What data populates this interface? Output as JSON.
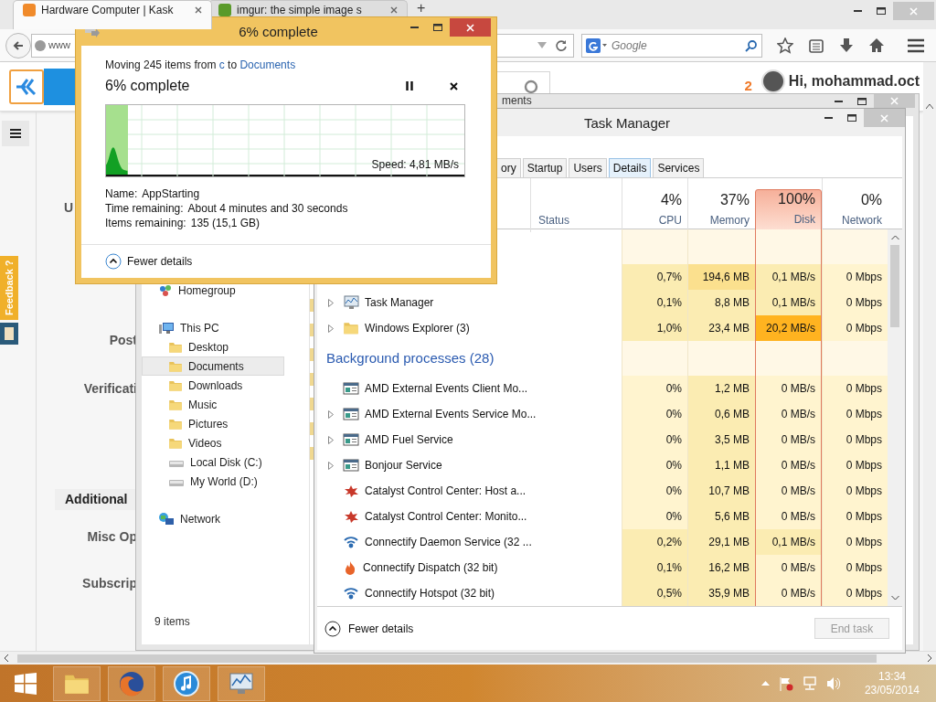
{
  "browser": {
    "tabs": [
      {
        "title": "Hardware Computer | Kask",
        "selected": true
      },
      {
        "title": "imgur: the simple image s",
        "selected": false
      }
    ],
    "new_tab": "+",
    "address": "www",
    "search_placeholder": "Google",
    "page": {
      "notification_count": "2",
      "greeting": "Hi, mohammad.oct",
      "feedback": "Feedback ?",
      "labels": [
        {
          "kind": "field",
          "text": "U"
        },
        {
          "kind": "field",
          "text": "Post"
        },
        {
          "kind": "field",
          "text": "Verificati"
        },
        {
          "kind": "section",
          "text": "Additional"
        },
        {
          "kind": "field",
          "text": "Misc Op"
        },
        {
          "kind": "field",
          "text": "Subscrip"
        }
      ]
    }
  },
  "explorer": {
    "title": "ments",
    "nav": [
      {
        "label": "Homegroup",
        "kind": "homegroup",
        "selected": false
      },
      {
        "label": "This PC",
        "kind": "pc",
        "selected": false,
        "children": [
          {
            "label": "Desktop",
            "kind": "folder",
            "selected": false
          },
          {
            "label": "Documents",
            "kind": "folder",
            "selected": true
          },
          {
            "label": "Downloads",
            "kind": "folder",
            "selected": false
          },
          {
            "label": "Music",
            "kind": "folder",
            "selected": false
          },
          {
            "label": "Pictures",
            "kind": "folder",
            "selected": false
          },
          {
            "label": "Videos",
            "kind": "folder",
            "selected": false
          },
          {
            "label": "Local Disk (C:)",
            "kind": "drive",
            "selected": false
          },
          {
            "label": "My World (D:)",
            "kind": "drive",
            "selected": false
          }
        ]
      },
      {
        "label": "Network",
        "kind": "network",
        "selected": false
      }
    ],
    "status": "9 items"
  },
  "task_manager": {
    "title": "Task Manager",
    "tabs": [
      {
        "label": "ory",
        "hovered": false
      },
      {
        "label": "Startup",
        "hovered": false
      },
      {
        "label": "Users",
        "hovered": false
      },
      {
        "label": "Details",
        "hovered": true
      },
      {
        "label": "Services",
        "hovered": false
      }
    ],
    "status_column": "Status",
    "columns": [
      {
        "percent": "4%",
        "label": "CPU",
        "alert": false
      },
      {
        "percent": "37%",
        "label": "Memory",
        "alert": false
      },
      {
        "percent": "100%",
        "label": "Disk",
        "alert": true
      },
      {
        "percent": "0%",
        "label": "Network",
        "alert": false
      }
    ],
    "rows": [
      {
        "kind": "group"
      },
      {
        "kind": "process",
        "cells": [
          {
            "text": "0,7%",
            "color": "#fbecb2"
          },
          {
            "text": "194,6 MB",
            "color": "#fbe08e"
          },
          {
            "text": "0,1 MB/s",
            "color": "#fbecb2"
          },
          {
            "text": "0 Mbps",
            "color": "#fff4cf"
          }
        ]
      },
      {
        "kind": "taskmgr",
        "name": "Task Manager",
        "expandable": true,
        "cells": [
          {
            "text": "0,1%",
            "color": "#fbecb2"
          },
          {
            "text": "8,8 MB",
            "color": "#fbecb2"
          },
          {
            "text": "0,1 MB/s",
            "color": "#fbecb2"
          },
          {
            "text": "0 Mbps",
            "color": "#fff4cf"
          }
        ]
      },
      {
        "kind": "explorer",
        "name": "Windows Explorer (3)",
        "expandable": true,
        "cells": [
          {
            "text": "1,0%",
            "color": "#fbecb2"
          },
          {
            "text": "23,4 MB",
            "color": "#fbecb2"
          },
          {
            "text": "20,2 MB/s",
            "color": "#ffb320"
          },
          {
            "text": "0 Mbps",
            "color": "#fff4cf"
          }
        ]
      },
      {
        "kind": "group",
        "label": "Background processes (28)"
      },
      {
        "kind": "app",
        "name": "AMD External Events Client Mo...",
        "expandable": false,
        "cells": [
          {
            "text": "0%",
            "color": "#fff4cf"
          },
          {
            "text": "1,2 MB",
            "color": "#fbecb2"
          },
          {
            "text": "0 MB/s",
            "color": "#fff4cf"
          },
          {
            "text": "0 Mbps",
            "color": "#fff4cf"
          }
        ]
      },
      {
        "kind": "app",
        "name": "AMD External Events Service Mo...",
        "expandable": true,
        "cells": [
          {
            "text": "0%",
            "color": "#fff4cf"
          },
          {
            "text": "0,6 MB",
            "color": "#fbecb2"
          },
          {
            "text": "0 MB/s",
            "color": "#fff4cf"
          },
          {
            "text": "0 Mbps",
            "color": "#fff4cf"
          }
        ]
      },
      {
        "kind": "app",
        "name": "AMD Fuel Service",
        "expandable": true,
        "cells": [
          {
            "text": "0%",
            "color": "#fff4cf"
          },
          {
            "text": "3,5 MB",
            "color": "#fbecb2"
          },
          {
            "text": "0 MB/s",
            "color": "#fff4cf"
          },
          {
            "text": "0 Mbps",
            "color": "#fff4cf"
          }
        ]
      },
      {
        "kind": "app",
        "name": "Bonjour Service",
        "expandable": true,
        "cells": [
          {
            "text": "0%",
            "color": "#fff4cf"
          },
          {
            "text": "1,1 MB",
            "color": "#fbecb2"
          },
          {
            "text": "0 MB/s",
            "color": "#fff4cf"
          },
          {
            "text": "0 Mbps",
            "color": "#fff4cf"
          }
        ]
      },
      {
        "kind": "catalyst",
        "name": "Catalyst Control Center: Host a...",
        "expandable": false,
        "cells": [
          {
            "text": "0%",
            "color": "#fff4cf"
          },
          {
            "text": "10,7 MB",
            "color": "#fbecb2"
          },
          {
            "text": "0 MB/s",
            "color": "#fff4cf"
          },
          {
            "text": "0 Mbps",
            "color": "#fff4cf"
          }
        ]
      },
      {
        "kind": "catalyst",
        "name": "Catalyst Control Center: Monito...",
        "expandable": false,
        "cells": [
          {
            "text": "0%",
            "color": "#fff4cf"
          },
          {
            "text": "5,6 MB",
            "color": "#fbecb2"
          },
          {
            "text": "0 MB/s",
            "color": "#fff4cf"
          },
          {
            "text": "0 Mbps",
            "color": "#fff4cf"
          }
        ]
      },
      {
        "kind": "wifi",
        "name": "Connectify Daemon Service (32 ...",
        "expandable": false,
        "cells": [
          {
            "text": "0,2%",
            "color": "#fbecb2"
          },
          {
            "text": "29,1 MB",
            "color": "#fbecb2"
          },
          {
            "text": "0,1 MB/s",
            "color": "#fbecb2"
          },
          {
            "text": "0 Mbps",
            "color": "#fff4cf"
          }
        ]
      },
      {
        "kind": "flame",
        "name": "Connectify Dispatch (32 bit)",
        "expandable": false,
        "cells": [
          {
            "text": "0,1%",
            "color": "#fbecb2"
          },
          {
            "text": "16,2 MB",
            "color": "#fbecb2"
          },
          {
            "text": "0 MB/s",
            "color": "#fff4cf"
          },
          {
            "text": "0 Mbps",
            "color": "#fff4cf"
          }
        ]
      },
      {
        "kind": "wifi",
        "name": "Connectify Hotspot (32 bit)",
        "expandable": false,
        "cells": [
          {
            "text": "0,5%",
            "color": "#fbecb2"
          },
          {
            "text": "35,9 MB",
            "color": "#fbecb2"
          },
          {
            "text": "0 MB/s",
            "color": "#fff4cf"
          },
          {
            "text": "0 Mbps",
            "color": "#fff4cf"
          }
        ]
      }
    ],
    "fewer_details": "Fewer details",
    "end_task": {
      "label": "End task",
      "disabled": true
    }
  },
  "copy_dialog": {
    "title": "6% complete",
    "summary": {
      "prefix": "Moving 245 items from",
      "source": "c",
      "middle": "to",
      "destination": "Documents"
    },
    "progress_text": "6% complete",
    "level": 0.06,
    "speed": "Speed: 4,81 MB/s",
    "details": [
      {
        "label": "Name:",
        "value": "AppStarting"
      },
      {
        "label": "Time remaining:",
        "value": "About 4 minutes and 30 seconds"
      },
      {
        "label": "Items remaining:",
        "value": "135 (15,1 GB)"
      }
    ],
    "fewer_details": "Fewer details"
  },
  "taskbar": {
    "apps": [
      {
        "kind": "folder"
      },
      {
        "kind": "browser"
      },
      {
        "kind": "music"
      },
      {
        "kind": "monitor"
      }
    ],
    "time": "13:34",
    "date": "23/05/2014"
  }
}
